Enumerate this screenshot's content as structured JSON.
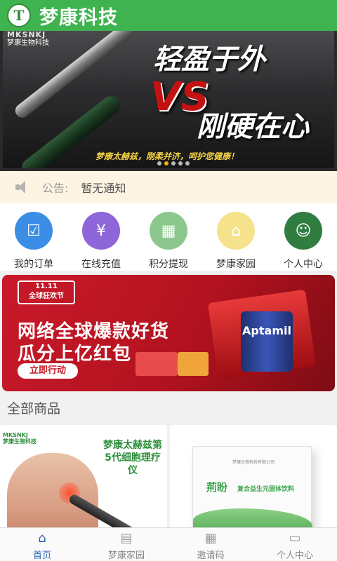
{
  "app": {
    "title": "梦康科技",
    "logo_letter": "T"
  },
  "banner": {
    "brand_en": "MKSNKJ",
    "brand_cn": "梦康生物科技",
    "slogan_top": "轻盈于外",
    "vs": "VS",
    "slogan_bottom": "刚硬在心",
    "subtitle": "梦康太赫兹，刚柔并济，呵护您健康！",
    "page_count": 5,
    "active_page": 2
  },
  "notice": {
    "label": "公告:",
    "text": "暂无通知",
    "icon": "speaker-icon"
  },
  "menu": {
    "items": [
      {
        "label": "我的订单",
        "icon": "clipboard-icon",
        "color": "#3a8ee6",
        "glyph": "☑"
      },
      {
        "label": "在线充值",
        "icon": "recharge-icon",
        "color": "#8f66d9",
        "glyph": "¥"
      },
      {
        "label": "积分提现",
        "icon": "points-icon",
        "color": "#8cc88e",
        "glyph": "▦"
      },
      {
        "label": "梦康家园",
        "icon": "home-icon",
        "color": "#f5e28a",
        "glyph": "⌂"
      },
      {
        "label": "个人中心",
        "icon": "user-icon",
        "color": "#2f7d3f",
        "glyph": "☺"
      }
    ]
  },
  "promo": {
    "badge_line1": "11.11",
    "badge_line2": "全球狂欢节",
    "line1": "网络全球爆款好货",
    "line2": "瓜分上亿红包",
    "button": "立即行动",
    "product_brand": "Aptamil"
  },
  "products_section": {
    "title": "全部商品"
  },
  "products": [
    {
      "tag_en": "MKSNKJ",
      "tag_cn": "梦康生物科技",
      "title": "梦康太赫兹第5代细胞理疗仪"
    },
    {
      "header": "梦康生物科技有限公司",
      "brand": "荊盼",
      "name": "复合益生元固体饮料"
    }
  ],
  "tabbar": {
    "tabs": [
      {
        "label": "首页",
        "icon": "home-icon",
        "active": true
      },
      {
        "label": "梦康家园",
        "icon": "building-icon",
        "active": false
      },
      {
        "label": "邀请码",
        "icon": "qrcode-icon",
        "active": false
      },
      {
        "label": "个人中心",
        "icon": "id-card-icon",
        "active": false
      }
    ]
  },
  "colors": {
    "primary": "#3fb34f",
    "tab_active": "#2b64b5",
    "notice_bg": "#fdf4e3",
    "promo_red": "#c91a2a"
  }
}
